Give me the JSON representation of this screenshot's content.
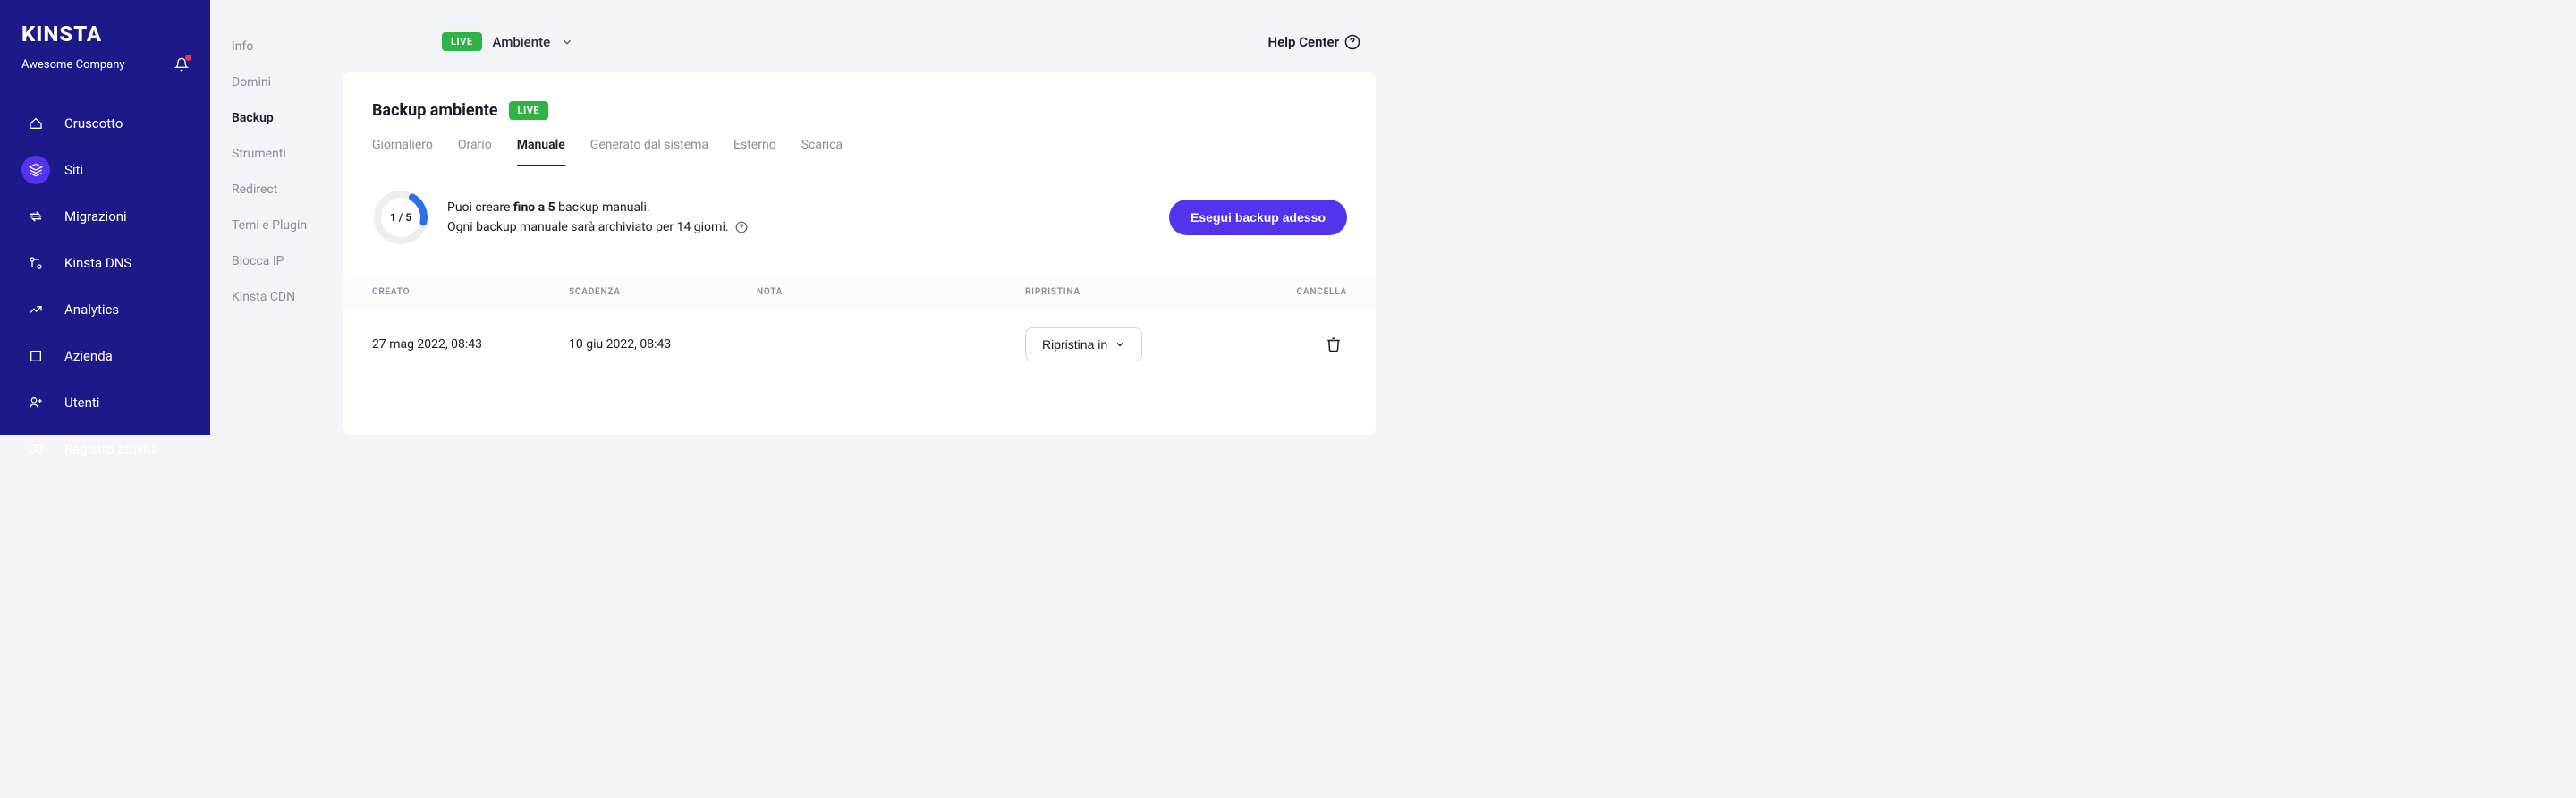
{
  "brand": {
    "logo": "KINSTA",
    "company": "Awesome Company"
  },
  "nav": {
    "items": [
      {
        "label": "Cruscotto",
        "icon": "home"
      },
      {
        "label": "Siti",
        "icon": "layers",
        "active": true
      },
      {
        "label": "Migrazioni",
        "icon": "arrows"
      },
      {
        "label": "Kinsta DNS",
        "icon": "dns"
      },
      {
        "label": "Analytics",
        "icon": "chart"
      },
      {
        "label": "Azienda",
        "icon": "building"
      },
      {
        "label": "Utenti",
        "icon": "users"
      },
      {
        "label": "Registro attività",
        "icon": "eye"
      }
    ]
  },
  "secondary_nav": {
    "items": [
      {
        "label": "Info"
      },
      {
        "label": "Domini"
      },
      {
        "label": "Backup",
        "active": true
      },
      {
        "label": "Strumenti"
      },
      {
        "label": "Redirect"
      },
      {
        "label": "Temi e Plugin"
      },
      {
        "label": "Blocca IP"
      },
      {
        "label": "Kinsta CDN"
      }
    ]
  },
  "topbar": {
    "live_badge": "LIVE",
    "env_label": "Ambiente",
    "help_center": "Help Center"
  },
  "header": {
    "title": "Backup ambiente",
    "live_badge": "LIVE"
  },
  "tabs": {
    "items": [
      {
        "label": "Giornaliero"
      },
      {
        "label": "Orario"
      },
      {
        "label": "Manuale",
        "active": true
      },
      {
        "label": "Generato dal sistema"
      },
      {
        "label": "Esterno"
      },
      {
        "label": "Scarica"
      }
    ]
  },
  "info": {
    "progress_label": "1 / 5",
    "line1_a": "Puoi creare ",
    "line1_b": "fino a 5",
    "line1_c": " backup manuali.",
    "line2": "Ogni backup manuale sarà archiviato per 14 giorni.",
    "button": "Esegui backup adesso"
  },
  "table": {
    "columns": {
      "created": "CREATO",
      "expires": "SCADENZA",
      "note": "NOTA",
      "restore": "RIPRISTINA",
      "delete": "CANCELLA"
    },
    "rows": [
      {
        "created": "27 mag 2022, 08:43",
        "expires": "10 giu 2022, 08:43",
        "note": "",
        "restore_label": "Ripristina in"
      }
    ]
  }
}
